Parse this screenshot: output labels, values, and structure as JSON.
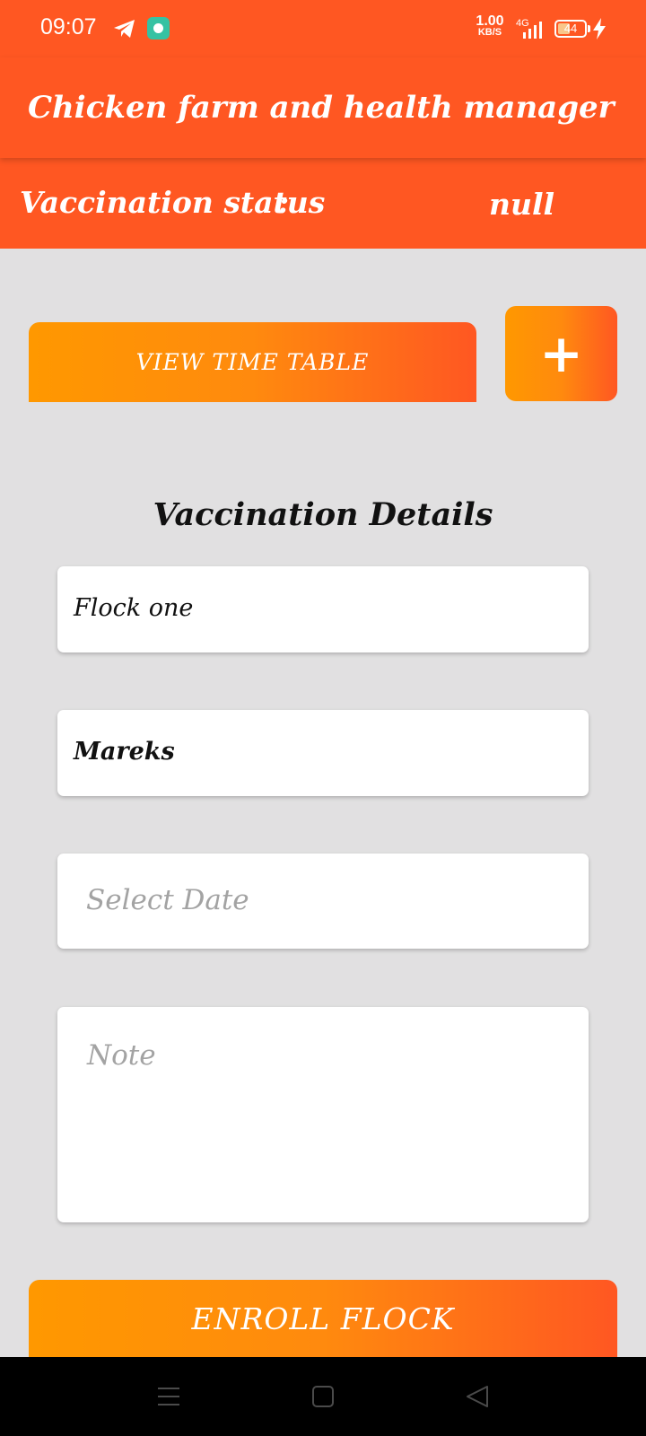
{
  "status_bar": {
    "time": "09:07",
    "net_speed_value": "1.00",
    "net_speed_unit": "KB/S",
    "network_type": "4G",
    "battery_level": "44",
    "battery_fraction": 0.44,
    "icons": [
      "telegram-icon",
      "app-notification-icon",
      "signal-icon",
      "battery-icon",
      "charging-icon"
    ]
  },
  "app_bar": {
    "title": "Chicken farm and health manager"
  },
  "vaccination_status": {
    "label": "Vaccination status",
    "separator": ":",
    "value": "null"
  },
  "actions": {
    "view_time_table": "VIEW TIME TABLE",
    "add": "+"
  },
  "details": {
    "title": "Vaccination Details",
    "flock_value": "Flock one",
    "vaccine_value": "Mareks",
    "date_placeholder": "Select Date",
    "note_placeholder": "Note"
  },
  "enroll_button": "ENROLL FLOCK",
  "colors": {
    "primary": "#ff5722",
    "gradient_start": "#ff9800",
    "background": "#e1e0e1"
  }
}
